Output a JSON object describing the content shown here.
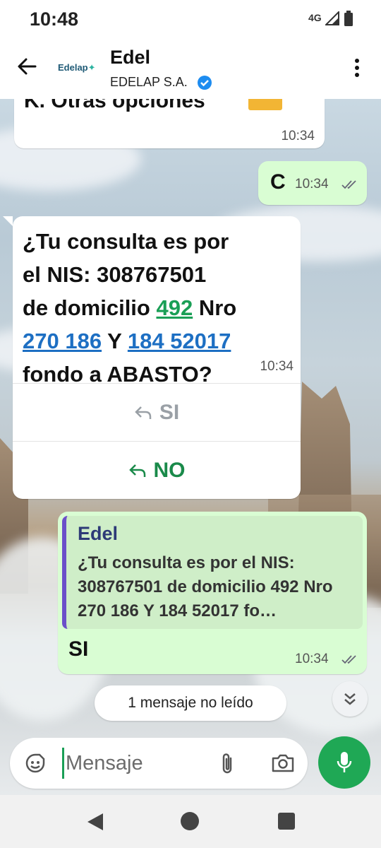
{
  "status_bar": {
    "time": "10:48",
    "network": "4G"
  },
  "header": {
    "logo_text": "Edelap",
    "title": "Edel",
    "subtitle": "EDELAP S.A."
  },
  "messages": {
    "m1": {
      "text": "K. Otras opciones",
      "time": "10:34"
    },
    "m2": {
      "text": "C",
      "time": "10:34"
    },
    "m3": {
      "line1": "¿Tu consulta es por",
      "line2": "el NIS: 308767501",
      "line3_pre": "de domicilio ",
      "line3_link": "492",
      "line3_post": " Nro",
      "line4_link1": "270 186",
      "line4_mid": " Y ",
      "line4_link2": "184 52017",
      "line5": "fondo a ABASTO?",
      "time": "10:34",
      "button_si": "SI",
      "button_no": "NO"
    },
    "m4": {
      "quote_name": "Edel",
      "quote_text": "¿Tu consulta es por el NIS: 308767501 de domicilio 492 Nro 270 186 Y 184 52017 fo…",
      "text": "SI",
      "time": "10:34"
    }
  },
  "unread_label": "1 mensaje no leído",
  "composer": {
    "placeholder": "Mensaje"
  },
  "colors": {
    "accent_green": "#1fa855",
    "outgoing_bubble": "#d9fdd3",
    "link_blue": "#1d6fc3",
    "link_green": "#1a9f56"
  }
}
